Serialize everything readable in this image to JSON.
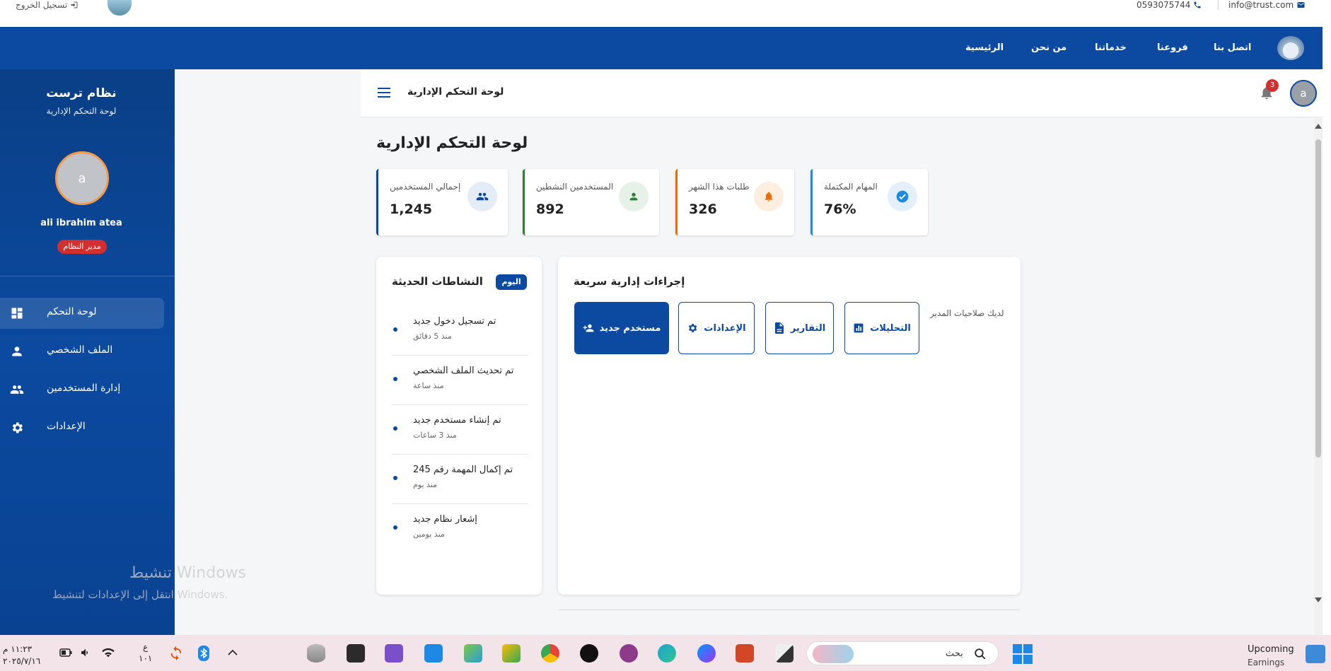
{
  "topbar": {
    "logout_label": "تسجيل الخروج",
    "phone": "0593075744",
    "email": "info@trust.com"
  },
  "nav": {
    "items": [
      "الرئيسية",
      "من نحن",
      "خدماتنا",
      "فروعنا",
      "اتصل بنا"
    ]
  },
  "sidebar": {
    "system_title": "نظام ترست",
    "system_subtitle": "لوحة التحكم الإدارية",
    "avatar_letter": "a",
    "user_name": "ali ibrahim atea",
    "role": "مدير النظام",
    "items": [
      {
        "label": "لوحة التحكم",
        "icon": "dashboard-icon",
        "active": true
      },
      {
        "label": "الملف الشخصي",
        "icon": "person-icon",
        "active": false
      },
      {
        "label": "إدارة المستخدمين",
        "icon": "people-icon",
        "active": false
      },
      {
        "label": "الإعدادات",
        "icon": "gear-icon",
        "active": false
      }
    ]
  },
  "header": {
    "title": "لوحة التحكم الإدارية",
    "notification_count": "3",
    "avatar_letter": "a"
  },
  "page": {
    "title": "لوحة التحكم الإدارية"
  },
  "stats": [
    {
      "label": "إجمالي المستخدمين",
      "value": "1,245",
      "icon": "people-icon",
      "color": "#0b4aa0"
    },
    {
      "label": "المستخدمين النشطين",
      "value": "892",
      "icon": "person-icon",
      "color": "#2e7d32"
    },
    {
      "label": "طلبات هذا الشهر",
      "value": "326",
      "icon": "bell-icon",
      "color": "#ef6c00"
    },
    {
      "label": "المهام المكتملة",
      "value": "76%",
      "icon": "check-circle-icon",
      "color": "#1e88e5"
    }
  ],
  "activity": {
    "title": "النشاطات الحديثة",
    "badge": "اليوم",
    "items": [
      {
        "title": "تم تسجيل دخول جديد",
        "time": "منذ 5 دقائق"
      },
      {
        "title": "تم تحديث الملف الشخصي",
        "time": "منذ ساعة"
      },
      {
        "title": "تم إنشاء مستخدم جديد",
        "time": "منذ 3 ساعات"
      },
      {
        "title": "تم إكمال المهمة رقم 245",
        "time": "منذ يوم"
      },
      {
        "title": "إشعار نظام جديد",
        "time": "منذ يومين"
      }
    ]
  },
  "quick_actions": {
    "title": "إجراءات إدارية سريعة",
    "permission_text": "لديك صلاحيات المدير",
    "buttons": [
      {
        "label": "مستخدم جديد",
        "icon": "add-user-icon"
      },
      {
        "label": "الإعدادات",
        "icon": "gear-icon"
      },
      {
        "label": "التقارير",
        "icon": "document-icon"
      },
      {
        "label": "التحليلات",
        "icon": "chart-icon"
      }
    ]
  },
  "watermark": {
    "title": "تنشيط Windows",
    "subtitle": "انتقل إلى الإعدادات لتنشيط Windows."
  },
  "taskbar": {
    "time": "١١:٢٣ م",
    "date": "٢٠٢٥/٧/١٦",
    "lang_top": "ع",
    "lang_bottom": "١٠١",
    "search_label": "بحث",
    "widget_line1": "Upcoming",
    "widget_line2": "Earnings"
  },
  "colors": {
    "primary": "#0b4aa0",
    "danger": "#d32f2f",
    "success": "#2e7d32",
    "warning": "#ef6c00"
  }
}
